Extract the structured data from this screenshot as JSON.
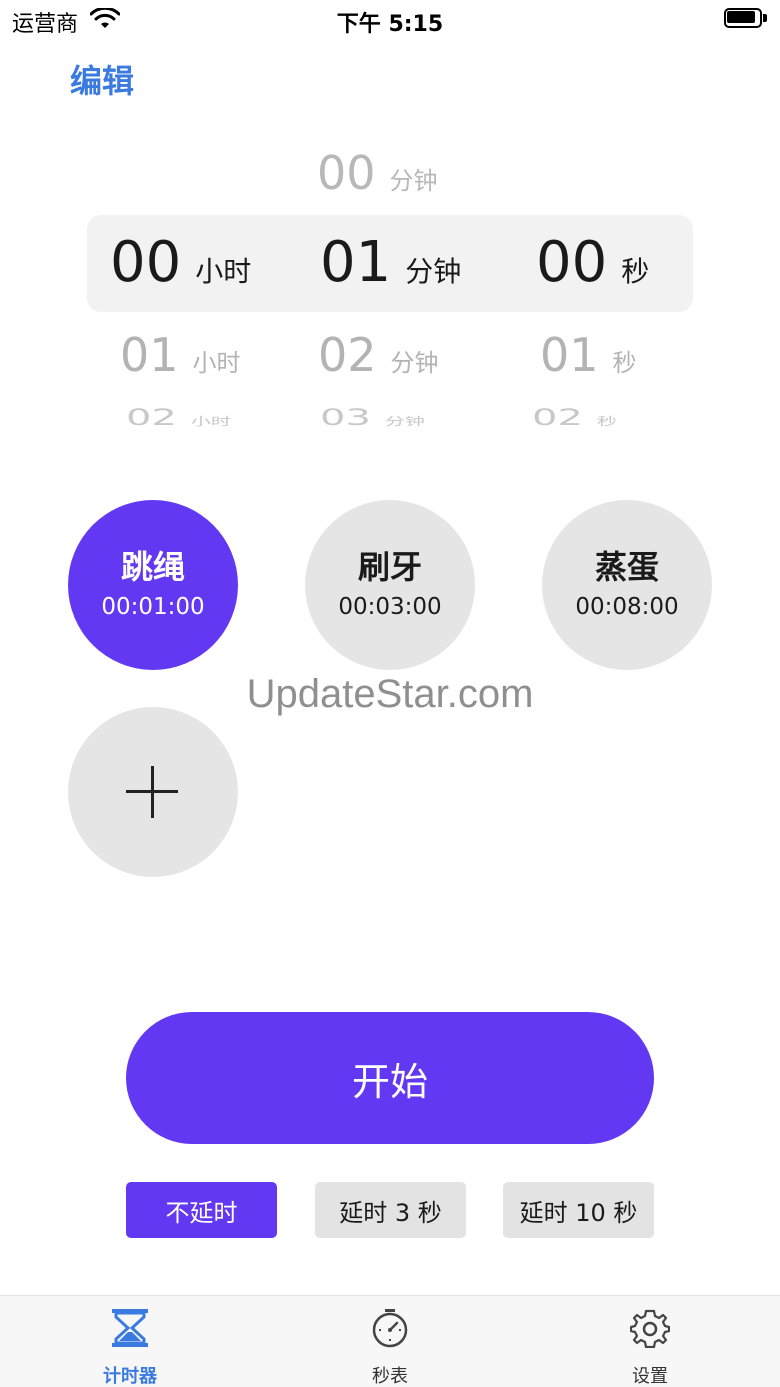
{
  "status_bar": {
    "carrier": "运营商",
    "time": "下午 5:15"
  },
  "header": {
    "edit_label": "编辑"
  },
  "picker": {
    "top_partial_minute": {
      "value": "00",
      "unit": "分钟"
    },
    "selected": {
      "hours": {
        "value": "00",
        "unit": "小时"
      },
      "minutes": {
        "value": "01",
        "unit": "分钟"
      },
      "seconds": {
        "value": "00",
        "unit": "秒"
      }
    },
    "next1": {
      "hours": {
        "value": "01",
        "unit": "小时"
      },
      "minutes": {
        "value": "02",
        "unit": "分钟"
      },
      "seconds": {
        "value": "01",
        "unit": "秒"
      }
    },
    "next2": {
      "hours": {
        "value": "02",
        "unit": "小时"
      },
      "minutes": {
        "value": "03",
        "unit": "分钟"
      },
      "seconds": {
        "value": "02",
        "unit": "秒"
      }
    }
  },
  "presets": [
    {
      "name": "跳绳",
      "time": "00:01:00",
      "active": true
    },
    {
      "name": "刷牙",
      "time": "00:03:00",
      "active": false
    },
    {
      "name": "蒸蛋",
      "time": "00:08:00",
      "active": false
    }
  ],
  "add_preset_icon": "plus-icon",
  "watermark": "UpdateStar.com",
  "start_label": "开始",
  "delay_options": [
    {
      "label": "不延时",
      "active": true
    },
    {
      "label": "延时 3 秒",
      "active": false
    },
    {
      "label": "延时 10 秒",
      "active": false
    }
  ],
  "tabs": [
    {
      "label": "计时器",
      "icon": "hourglass-icon",
      "active": true
    },
    {
      "label": "秒表",
      "icon": "stopwatch-icon",
      "active": false
    },
    {
      "label": "设置",
      "icon": "gear-icon",
      "active": false
    }
  ],
  "colors": {
    "accent": "#6338f2",
    "link": "#3b7be0",
    "neutral_circle": "#e5e5e5",
    "picker_highlight": "#f2f2f2"
  }
}
